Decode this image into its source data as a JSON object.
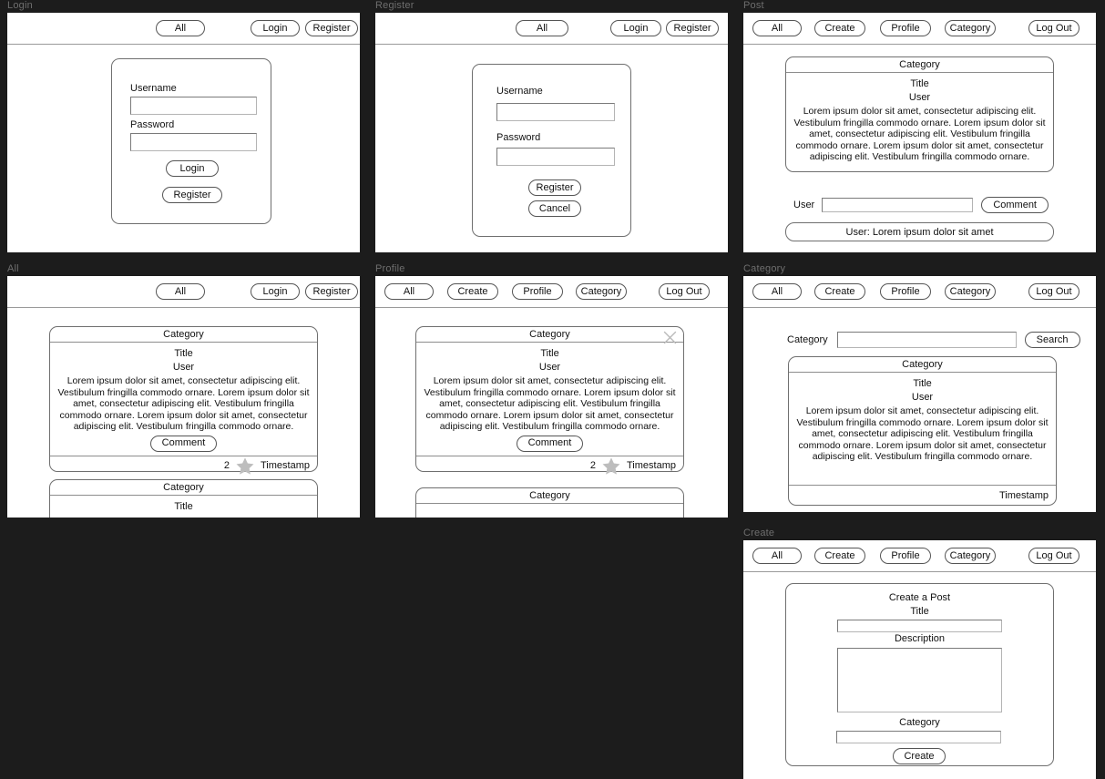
{
  "canvas": {
    "background": "#1c1c1c",
    "label_color": "#6e6e6e",
    "line_color": "#6f6f6f"
  },
  "lorem": "Lorem ipsum dolor sit amet, consectetur adipiscing elit. Vestibulum fringilla commodo ornare. Lorem ipsum dolor sit amet, consectetur adipiscing elit. Vestibulum fringilla commodo ornare. Lorem ipsum dolor sit amet, consectetur adipiscing elit. Vestibulum fringilla commodo ornare.",
  "frames": {
    "login": {
      "label": "Login",
      "nav": {
        "all": "All",
        "login": "Login",
        "register": "Register"
      },
      "form": {
        "username_label": "Username",
        "username_value": "",
        "password_label": "Password",
        "password_value": "",
        "login_button": "Login",
        "register_button": "Register"
      }
    },
    "register": {
      "label": "Register",
      "nav": {
        "all": "All",
        "login": "Login",
        "register": "Register"
      },
      "form": {
        "username_label": "Username",
        "username_value": "",
        "password_label": "Password",
        "password_value": "",
        "register_button": "Register",
        "cancel_button": "Cancel"
      }
    },
    "post": {
      "label": "Post",
      "nav": {
        "all": "All",
        "create": "Create",
        "profile": "Profile",
        "category": "Category",
        "logout": "Log Out"
      },
      "card": {
        "category": "Category",
        "title": "Title",
        "user": "User"
      },
      "comment_form": {
        "user_label": "User",
        "input_value": "",
        "button": "Comment"
      },
      "comment_item": "User: Lorem ipsum dolor sit amet"
    },
    "all": {
      "label": "All",
      "nav": {
        "all": "All",
        "login": "Login",
        "register": "Register"
      },
      "card1": {
        "category": "Category",
        "title": "Title",
        "user": "User",
        "comment_button": "Comment",
        "star_count": "2",
        "timestamp": "Timestamp"
      },
      "card2": {
        "category": "Category",
        "title": "Title"
      }
    },
    "profile": {
      "label": "Profile",
      "nav": {
        "all": "All",
        "create": "Create",
        "profile": "Profile",
        "category": "Category",
        "logout": "Log Out"
      },
      "card1": {
        "category": "Category",
        "title": "Title",
        "user": "User",
        "comment_button": "Comment",
        "star_count": "2",
        "timestamp": "Timestamp",
        "close_icon": "close-icon"
      },
      "card2": {
        "category": "Category"
      }
    },
    "category": {
      "label": "Category",
      "nav": {
        "all": "All",
        "create": "Create",
        "profile": "Profile",
        "category": "Category",
        "logout": "Log Out"
      },
      "search": {
        "label": "Category",
        "input_value": "",
        "button": "Search"
      },
      "card": {
        "category": "Category",
        "title": "Title",
        "user": "User",
        "timestamp": "Timestamp"
      }
    },
    "create": {
      "label": "Create",
      "nav": {
        "all": "All",
        "create": "Create",
        "profile": "Profile",
        "category": "Category",
        "logout": "Log Out"
      },
      "form": {
        "heading": "Create a Post",
        "title_label": "Title",
        "title_value": "",
        "description_label": "Description",
        "description_value": "",
        "category_label": "Category",
        "category_value": "",
        "create_button": "Create"
      }
    }
  }
}
